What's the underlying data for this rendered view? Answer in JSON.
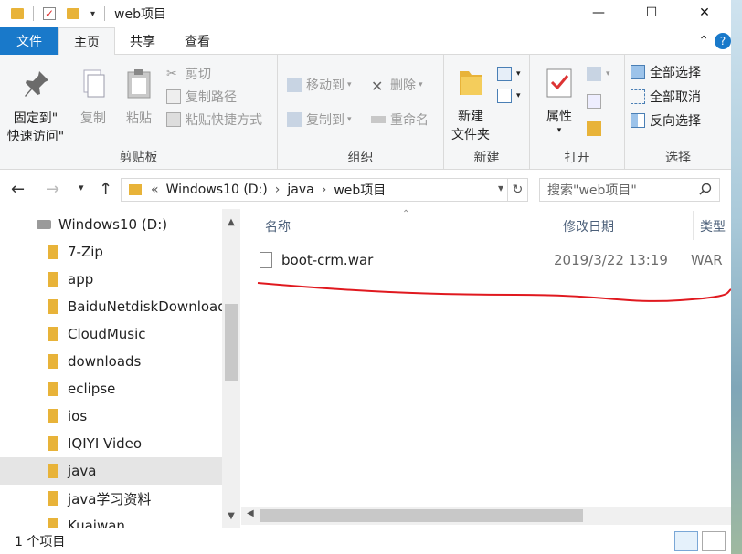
{
  "window": {
    "title": "web项目"
  },
  "titlebar_controls": {
    "minimize": "—",
    "maximize": "☐",
    "close": "✕"
  },
  "tabs": [
    {
      "label": "文件"
    },
    {
      "label": "主页"
    },
    {
      "label": "共享"
    },
    {
      "label": "查看"
    }
  ],
  "ribbon": {
    "clipboard": {
      "pin": "固定到\"\n快速访问\"",
      "pin_line1": "固定到\"",
      "pin_line2": "快速访问\"",
      "copy": "复制",
      "paste": "粘贴",
      "cut": "剪切",
      "copy_path": "复制路径",
      "paste_shortcut": "粘贴快捷方式",
      "label": "剪贴板"
    },
    "organize": {
      "move_to": "移动到",
      "copy_to": "复制到",
      "delete": "删除",
      "rename": "重命名",
      "label": "组织"
    },
    "new": {
      "new_folder_line1": "新建",
      "new_folder_line2": "文件夹",
      "label": "新建"
    },
    "open": {
      "properties": "属性",
      "label": "打开"
    },
    "select": {
      "select_all": "全部选择",
      "select_none": "全部取消",
      "invert": "反向选择",
      "label": "选择"
    }
  },
  "address": {
    "prefix": "«",
    "segments": [
      "Windows10 (D:)",
      "java",
      "web项目"
    ],
    "search_placeholder": "搜索\"web项目\""
  },
  "nav_pane": {
    "items": [
      {
        "label": "Windows10 (D:)",
        "type": "drive"
      },
      {
        "label": "7-Zip"
      },
      {
        "label": "app"
      },
      {
        "label": "BaiduNetdiskDownload"
      },
      {
        "label": "CloudMusic"
      },
      {
        "label": "downloads"
      },
      {
        "label": "eclipse"
      },
      {
        "label": "ios"
      },
      {
        "label": "IQIYI Video"
      },
      {
        "label": "java",
        "selected": true
      },
      {
        "label": "java学习资料"
      },
      {
        "label": "Kuaiwan"
      }
    ]
  },
  "content": {
    "columns": [
      "名称",
      "修改日期",
      "类型"
    ],
    "rows": [
      {
        "name": "boot-crm.war",
        "modified": "2019/3/22 13:19",
        "type": "WAR"
      }
    ]
  },
  "status": {
    "count": "1 个项目"
  },
  "colors": {
    "accent": "#1979ca",
    "folder": "#e8b339",
    "annotation_line": "#e0191f"
  }
}
